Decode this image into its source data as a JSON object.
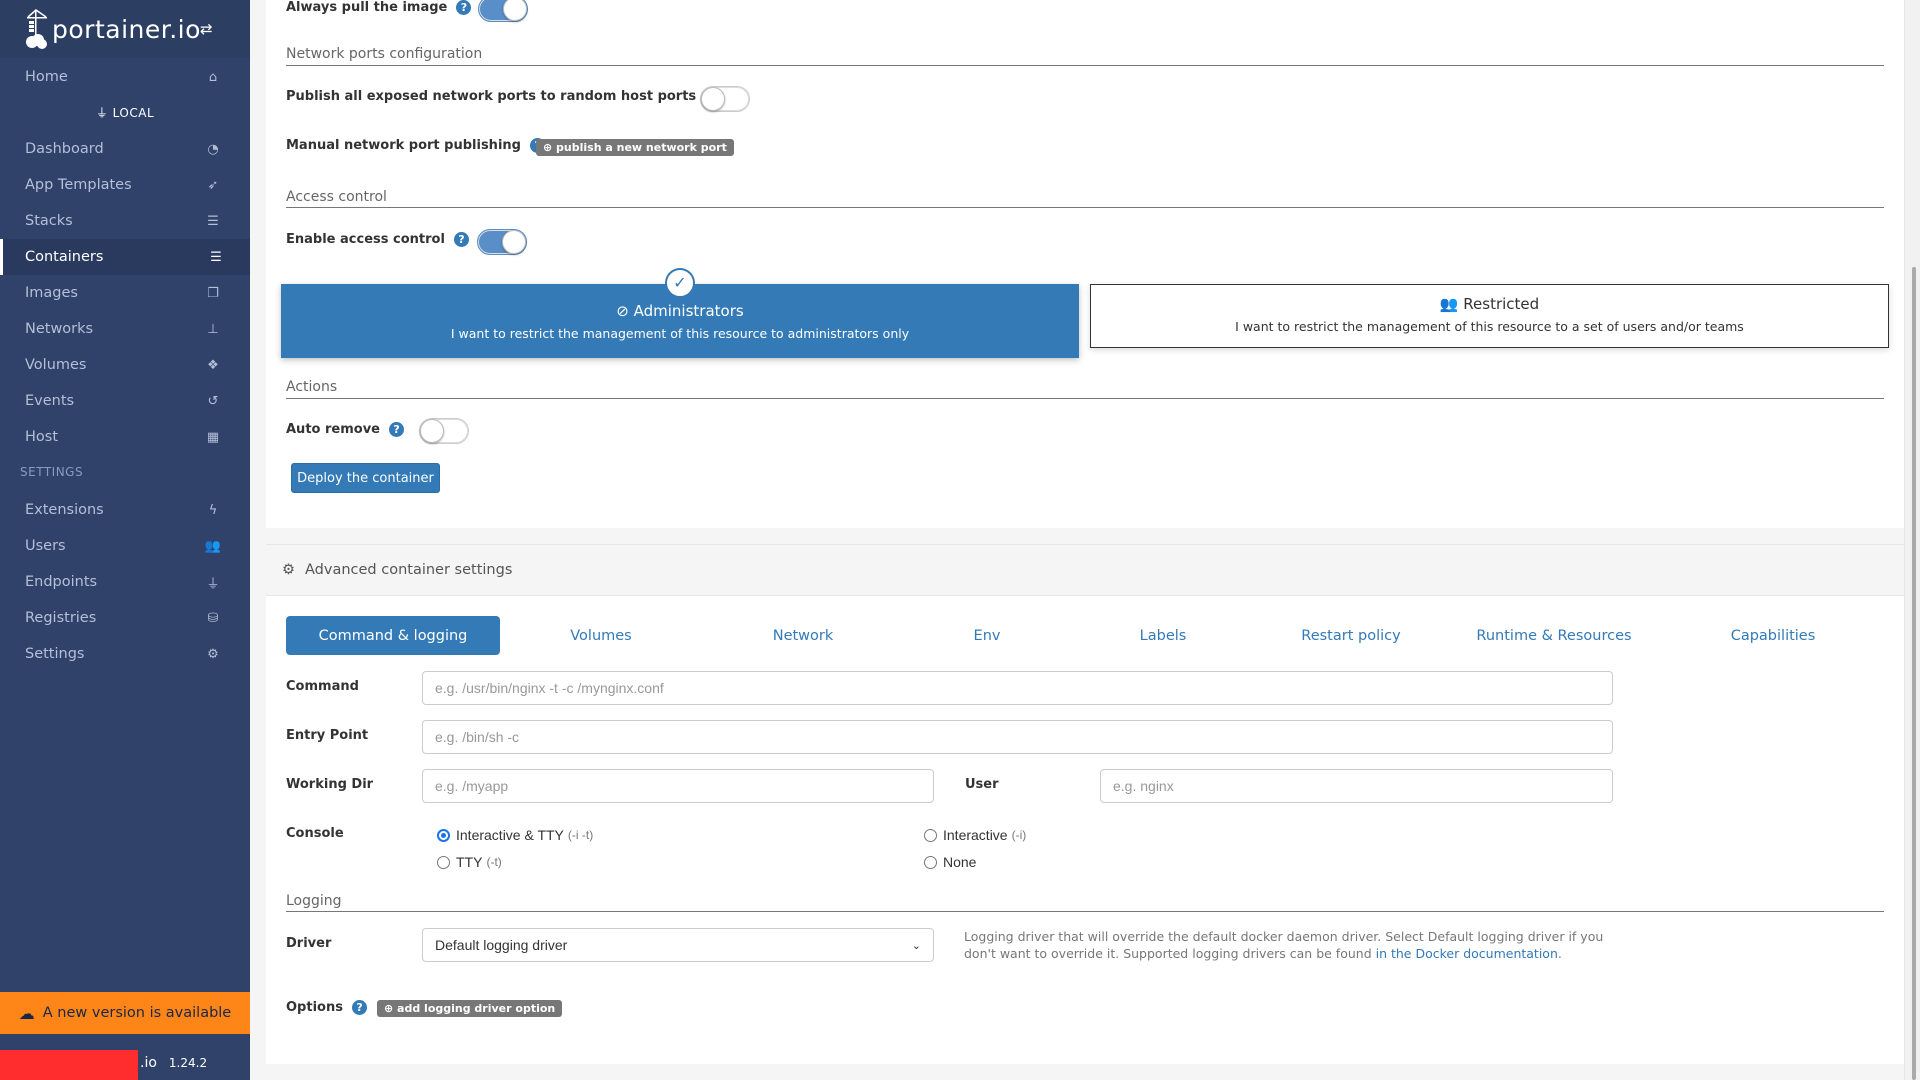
{
  "app": {
    "logo_text": "portainer.io",
    "version": "1.24.2",
    "footer_brand": ".io"
  },
  "sidebar": {
    "home": {
      "label": "Home",
      "icon": "home-icon"
    },
    "endpoint": "LOCAL",
    "items": [
      {
        "label": "Dashboard",
        "icon": "tachometer-icon"
      },
      {
        "label": "App Templates",
        "icon": "rocket-icon"
      },
      {
        "label": "Stacks",
        "icon": "th-list-icon"
      },
      {
        "label": "Containers",
        "icon": "server-icon",
        "active": true
      },
      {
        "label": "Images",
        "icon": "clone-icon"
      },
      {
        "label": "Networks",
        "icon": "sitemap-icon"
      },
      {
        "label": "Volumes",
        "icon": "cubes-icon"
      },
      {
        "label": "Events",
        "icon": "history-icon"
      },
      {
        "label": "Host",
        "icon": "th-icon"
      }
    ],
    "settings_title": "SETTINGS",
    "settings_items": [
      {
        "label": "Extensions",
        "icon": "bolt-icon"
      },
      {
        "label": "Users",
        "icon": "users-icon"
      },
      {
        "label": "Endpoints",
        "icon": "plug-icon"
      },
      {
        "label": "Registries",
        "icon": "database-icon"
      },
      {
        "label": "Settings",
        "icon": "cogs-icon"
      }
    ],
    "update_banner": "A new version is available"
  },
  "form": {
    "always_pull": {
      "label": "Always pull the image",
      "value": true
    },
    "network_ports": {
      "title": "Network ports configuration",
      "publish_all": {
        "label": "Publish all exposed network ports to random host ports",
        "value": false
      },
      "manual": {
        "label": "Manual network port publishing",
        "button": "publish a new network port"
      }
    },
    "access_control": {
      "title": "Access control",
      "enable": {
        "label": "Enable access control",
        "value": true
      },
      "options": [
        {
          "title": "Administrators",
          "desc": "I want to restrict the management of this resource to administrators only",
          "selected": true
        },
        {
          "title": "Restricted",
          "desc": "I want to restrict the management of this resource to a set of users and/or teams",
          "selected": false
        }
      ]
    },
    "actions": {
      "title": "Actions",
      "auto_remove": {
        "label": "Auto remove",
        "value": false
      },
      "deploy_button": "Deploy the container"
    }
  },
  "advanced": {
    "title": "Advanced container settings",
    "tabs": [
      "Command & logging",
      "Volumes",
      "Network",
      "Env",
      "Labels",
      "Restart policy",
      "Runtime & Resources",
      "Capabilities"
    ],
    "active_tab": 0,
    "command": {
      "label": "Command",
      "placeholder": "e.g. /usr/bin/nginx -t -c /mynginx.conf",
      "value": ""
    },
    "entrypoint": {
      "label": "Entry Point",
      "placeholder": "e.g. /bin/sh -c",
      "value": ""
    },
    "working_dir": {
      "label": "Working Dir",
      "placeholder": "e.g. /myapp",
      "value": ""
    },
    "user": {
      "label": "User",
      "placeholder": "e.g. nginx",
      "value": ""
    },
    "console": {
      "label": "Console",
      "options": [
        {
          "label": "Interactive & TTY",
          "flag": "(-i -t)",
          "selected": true
        },
        {
          "label": "TTY",
          "flag": "(-t)",
          "selected": false
        },
        {
          "label": "Interactive",
          "flag": "(-i)",
          "selected": false
        },
        {
          "label": "None",
          "flag": "",
          "selected": false
        }
      ]
    },
    "logging": {
      "title": "Logging",
      "driver_label": "Driver",
      "driver_value": "Default logging driver",
      "help_text": "Logging driver that will override the default docker daemon driver. Select Default logging driver if you don't want to override it. Supported logging drivers can be found ",
      "help_link": "in the Docker documentation",
      "help_end": ".",
      "options_label": "Options",
      "add_option_button": "add logging driver option"
    }
  },
  "colors": {
    "primary": "#337ab7",
    "sidebar": "#30426a",
    "banner": "#fe8618"
  }
}
